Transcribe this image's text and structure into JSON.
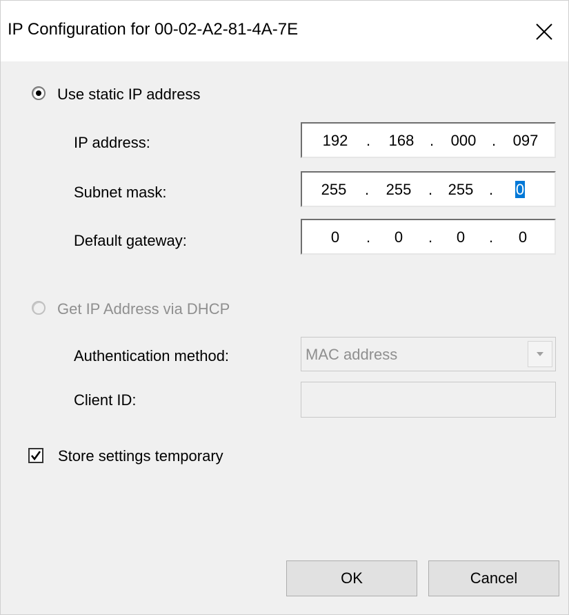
{
  "window": {
    "title": "IP Configuration for  00-02-A2-81-4A-7E"
  },
  "static": {
    "radio_label": "Use static IP address",
    "selected": true,
    "ip_address": {
      "label": "IP address:",
      "octets": [
        "192",
        "168",
        "000",
        "097"
      ]
    },
    "subnet_mask": {
      "label": "Subnet mask:",
      "octets": [
        "255",
        "255",
        "255",
        "0"
      ]
    },
    "default_gateway": {
      "label": "Default gateway:",
      "octets": [
        "0",
        "0",
        "0",
        "0"
      ]
    },
    "separator": "."
  },
  "dhcp": {
    "radio_label": "Get IP Address via DHCP",
    "selected": false,
    "enabled": false,
    "auth_method": {
      "label": "Authentication method:",
      "value": "MAC address"
    },
    "client_id": {
      "label": "Client ID:",
      "value": ""
    }
  },
  "store_settings": {
    "label": "Store settings temporary",
    "checked": true
  },
  "buttons": {
    "ok": "OK",
    "cancel": "Cancel"
  },
  "colors": {
    "selection": "#0078d7",
    "disabled_text": "#8f8f8f"
  },
  "icons": {
    "close": "close-icon",
    "dropdown": "chevron-down-icon",
    "check": "check-icon"
  }
}
